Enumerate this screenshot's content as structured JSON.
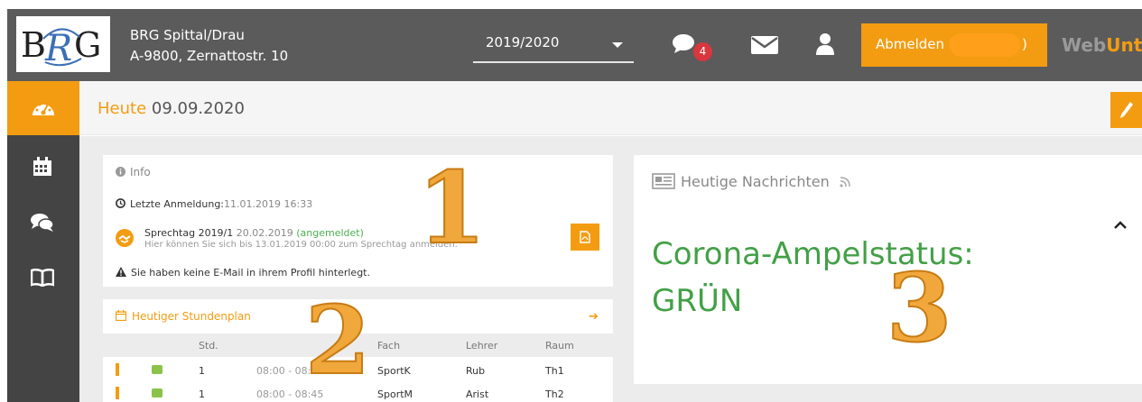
{
  "header": {
    "logo_text": "BRG",
    "school_name": "BRG Spittal/Drau",
    "school_address": "A-9800, Zernattostr. 10",
    "school_year": "2019/2020",
    "message_count": "4",
    "logout_label": "Abmelden (",
    "logout_close": ")",
    "brand_prefix": "Web",
    "brand_suffix": "Unti"
  },
  "sidebar": {
    "items": [
      {
        "icon": "dashboard-icon",
        "active": true
      },
      {
        "icon": "calendar-icon",
        "active": false
      },
      {
        "icon": "chat-icon",
        "active": false
      },
      {
        "icon": "book-icon",
        "active": false
      }
    ]
  },
  "page": {
    "title": "Heute",
    "date": "09.09.2020"
  },
  "info": {
    "heading": "Info",
    "last_login_label": "Letzte Anmeldung:",
    "last_login_value": "11.01.2019 16:33",
    "sprechtag_title": "Sprechtag 2019/1",
    "sprechtag_date": "20.02.2019",
    "sprechtag_status": "(angemeldet)",
    "sprechtag_note": "Hier können Sie sich bis 13.01.2019 00:00 zum Sprechtag anmelden.",
    "warning": "Sie haben keine E-Mail in ihrem Profil hinterlegt."
  },
  "schedule": {
    "heading": "Heutiger Stundenplan",
    "columns": {
      "std": "Std.",
      "fach": "Fach",
      "lehrer": "Lehrer",
      "raum": "Raum"
    },
    "rows": [
      {
        "std": "1",
        "time": "08:00 - 08:45",
        "fach": "SportK",
        "lehrer": "Rub",
        "raum": "Th1"
      },
      {
        "std": "1",
        "time": "08:00 - 08:45",
        "fach": "SportM",
        "lehrer": "Arist",
        "raum": "Th2"
      }
    ]
  },
  "news": {
    "heading": "Heutige Nachrichten",
    "body_line1": "Corona-Ampelstatus:",
    "body_line2": "GRÜN"
  },
  "annotations": [
    "1",
    "2",
    "3"
  ],
  "colors": {
    "accent": "#f39c12",
    "topbar": "#5b5b5b",
    "sidebar": "#444444",
    "status_green": "#43a047",
    "badge": "#d9363e"
  }
}
